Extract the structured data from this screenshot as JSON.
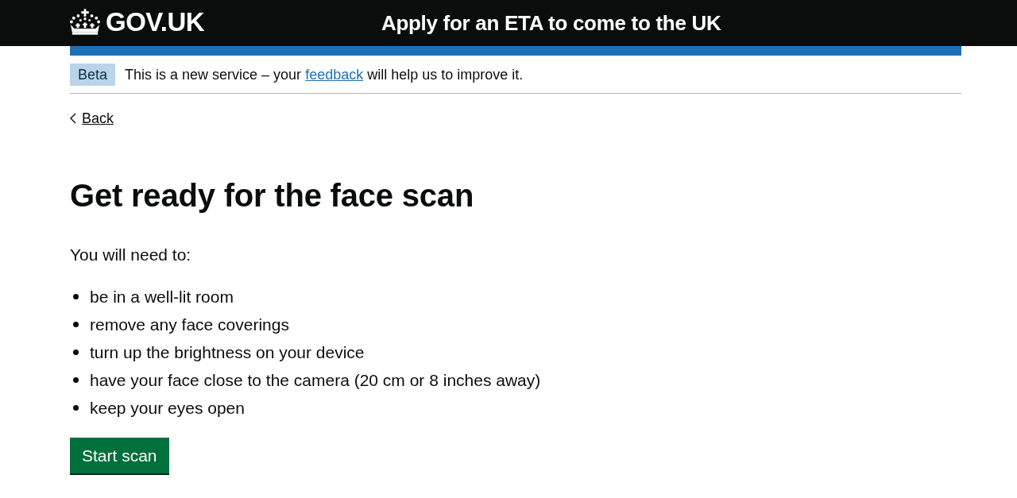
{
  "header": {
    "logo_text": "GOV.UK",
    "service_name": "Apply for an ETA to come to the UK"
  },
  "phase_banner": {
    "tag": "Beta",
    "text_before": "This is a new service – your",
    "link": "feedback",
    "text_after": "will help us to improve it."
  },
  "back_link": {
    "label": "Back"
  },
  "heading": "Get ready for the face scan",
  "intro": "You will need to:",
  "requirements": [
    "be in a well-lit room",
    "remove any face coverings",
    "turn up the brightness on your device",
    "have your face close to the camera (20 cm or 8 inches away)",
    "keep your eyes open"
  ],
  "primary_button": {
    "label": "Start scan"
  }
}
